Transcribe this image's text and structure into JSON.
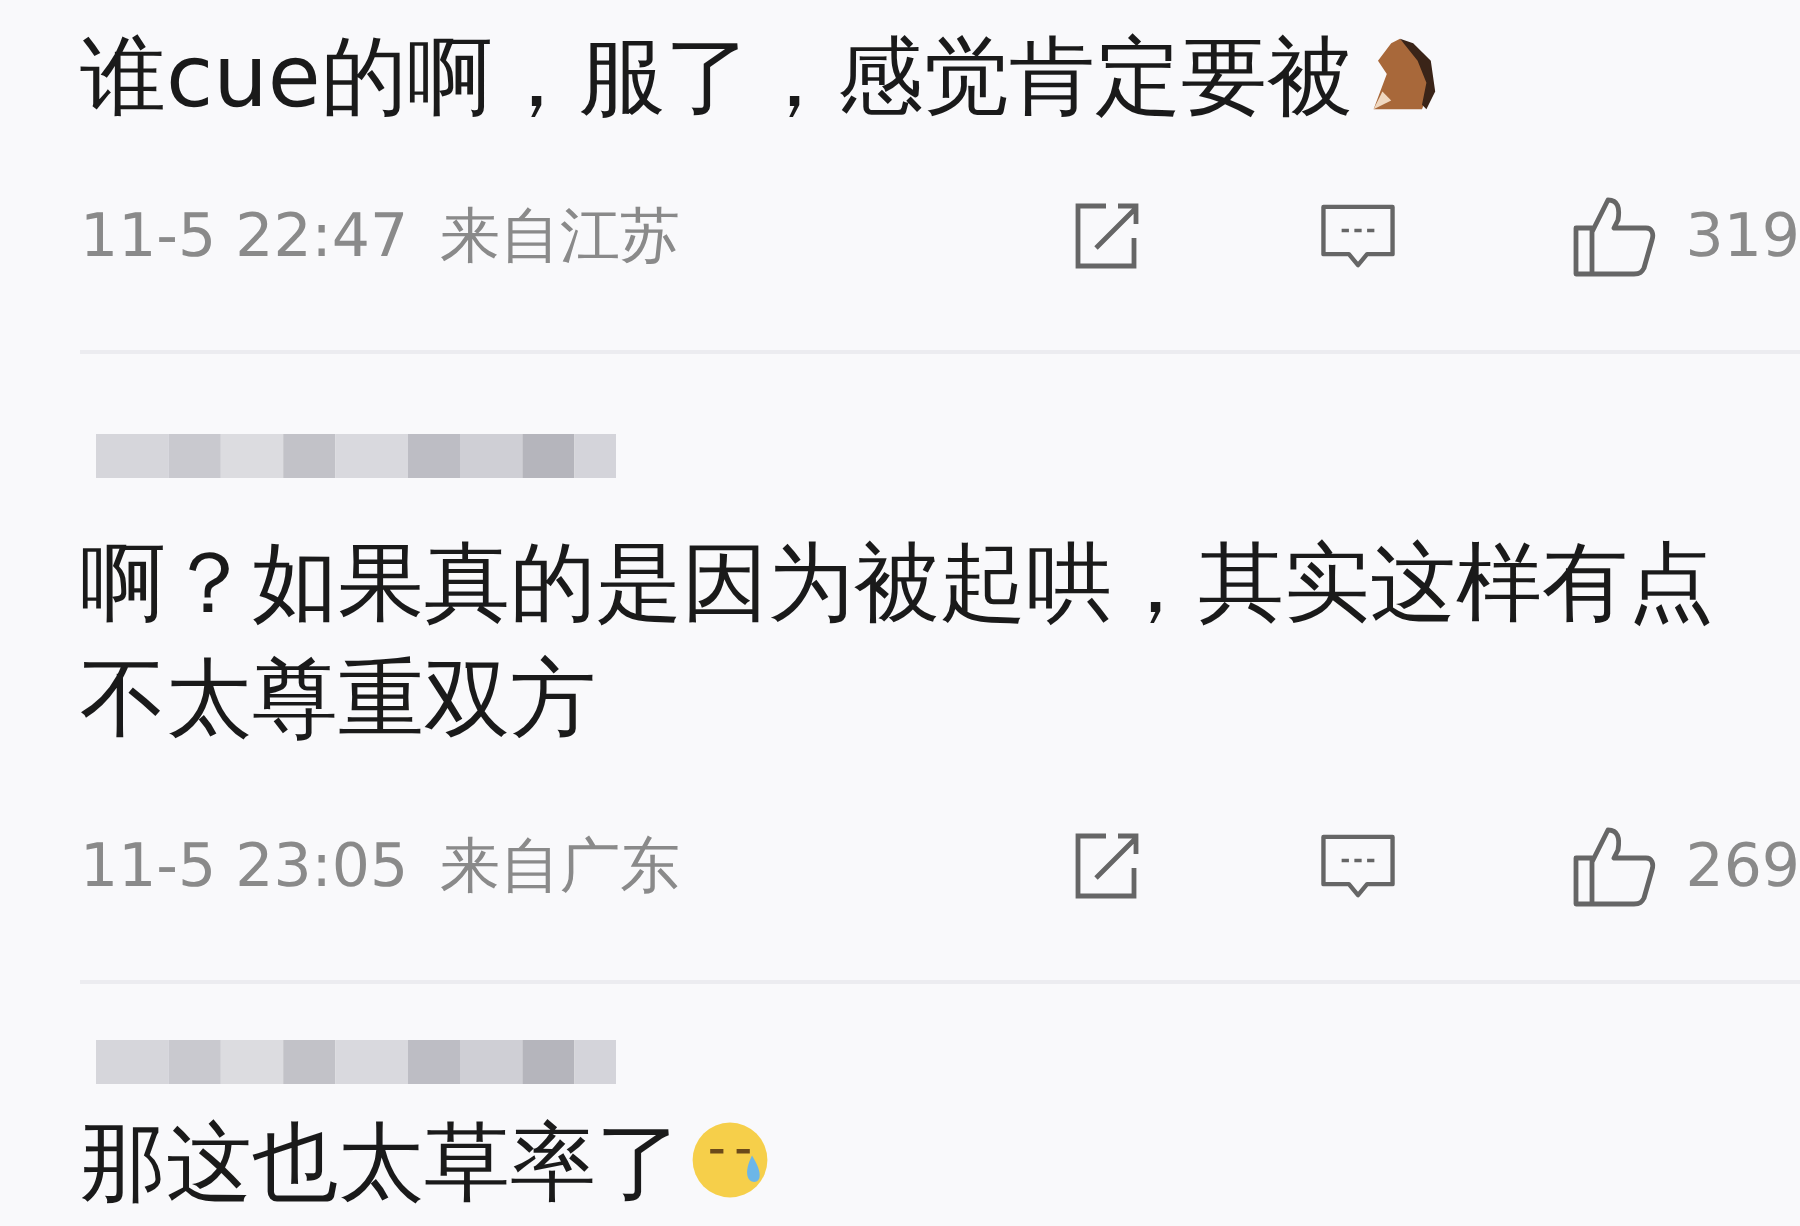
{
  "comments": [
    {
      "text": "谁cue的啊，服了，感觉肯定要被",
      "emoji": {
        "kind": "horse"
      },
      "meta": {
        "time": "11-5 22:47",
        "location": "来自江苏",
        "likes": "319"
      }
    },
    {
      "username_blurred": true,
      "text": "啊？如果真的是因为被起哄，其实这样有点不太尊重双方",
      "meta": {
        "time": "11-5 23:05",
        "location": "来自广东",
        "likes": "269"
      }
    },
    {
      "username_blurred": true,
      "text": "那这也太草率了",
      "emoji": {
        "kind": "sweat"
      }
    }
  ]
}
